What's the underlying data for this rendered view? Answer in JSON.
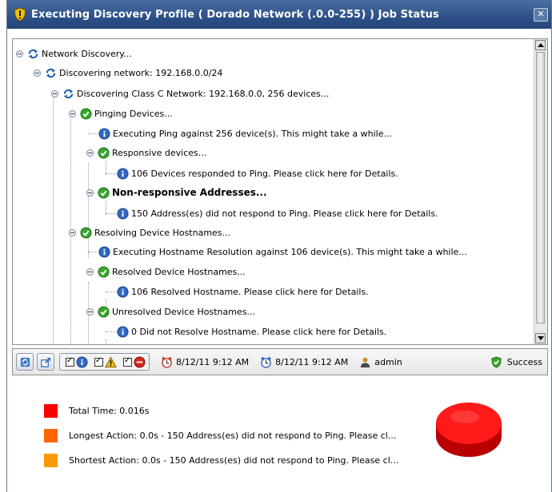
{
  "window": {
    "title": "Executing Discovery Profile ( Dorado Network (.0.0-255) ) Job Status",
    "close_glyph": "✕"
  },
  "tree": {
    "nodes": [
      {
        "label": "Network Discovery...",
        "icon": "refresh-icon",
        "expandable": true,
        "bold": false
      },
      {
        "label": "Discovering network: 192.168.0.0/24",
        "icon": "refresh-icon",
        "expandable": true,
        "bold": false
      },
      {
        "label": "Discovering Class C Network: 192.168.0.0, 256 devices...",
        "icon": "refresh-icon",
        "expandable": true,
        "bold": false
      },
      {
        "label": "Pinging Devices...",
        "icon": "check-icon",
        "expandable": true,
        "bold": false
      },
      {
        "label": "Executing Ping against 256 device(s). This might take a while...",
        "icon": "info-icon",
        "expandable": false,
        "bold": false
      },
      {
        "label": "Responsive devices...",
        "icon": "check-icon",
        "expandable": true,
        "bold": false
      },
      {
        "label": "106 Devices responded to Ping. Please click here for Details.",
        "icon": "info-icon",
        "expandable": false,
        "bold": false
      },
      {
        "label": "Non-responsive Addresses...",
        "icon": "check-icon",
        "expandable": true,
        "bold": true
      },
      {
        "label": "150 Address(es) did not respond to Ping. Please click here for Details.",
        "icon": "info-icon",
        "expandable": false,
        "bold": false
      },
      {
        "label": "Resolving Device Hostnames...",
        "icon": "check-icon",
        "expandable": true,
        "bold": false
      },
      {
        "label": "Executing Hostname Resolution against 106 device(s). This might take a while...",
        "icon": "info-icon",
        "expandable": false,
        "bold": false
      },
      {
        "label": "Resolved Device Hostnames...",
        "icon": "check-icon",
        "expandable": true,
        "bold": false
      },
      {
        "label": "106 Resolved Hostname. Please click here for Details.",
        "icon": "info-icon",
        "expandable": false,
        "bold": false
      },
      {
        "label": "Unresolved Device Hostnames...",
        "icon": "check-icon",
        "expandable": true,
        "bold": false
      },
      {
        "label": "0 Did not Resolve Hostname. Please click here for Details.",
        "icon": "info-icon",
        "expandable": false,
        "bold": false
      }
    ]
  },
  "toolbar": {
    "refresh_icon": "refresh-icon",
    "export_icon": "export-icon",
    "filters": [
      {
        "icon": "info-icon",
        "checked": true
      },
      {
        "icon": "warning-icon",
        "checked": true
      },
      {
        "icon": "error-icon",
        "checked": true
      }
    ],
    "start_time": "8/12/11 9:12 AM",
    "end_time": "8/12/11 9:12 AM",
    "user": "admin",
    "status": "Success"
  },
  "summary": {
    "items": [
      {
        "text": "Total Time: 0.016s",
        "color": "#ff0000"
      },
      {
        "text": "Longest Action: 0.0s - 150 Address(es) did not respond to Ping. Please cl...",
        "color": "#ff6600"
      },
      {
        "text": "Shortest Action: 0.0s - 150 Address(es) did not respond to Ping. Please cl...",
        "color": "#ff9900"
      }
    ],
    "pie_color": "#ff0000"
  }
}
